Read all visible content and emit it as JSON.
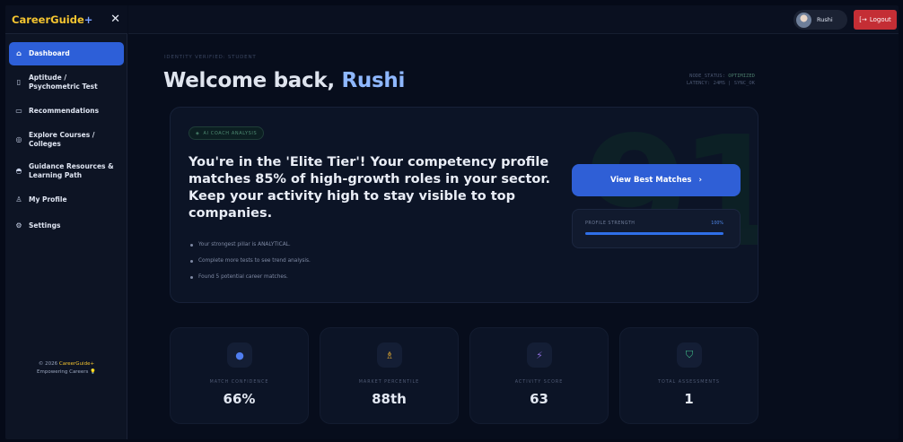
{
  "sidebar": {
    "brand": "CareerGuide",
    "brand_suffix": "+",
    "close": "✕",
    "items": [
      {
        "label": "Dashboard",
        "icon": "⌂"
      },
      {
        "label": "Aptitude / Psychometric Test",
        "icon": "▯"
      },
      {
        "label": "Recommendations",
        "icon": "▭"
      },
      {
        "label": "Explore Courses / Colleges",
        "icon": "◎"
      },
      {
        "label": "Guidance Resources & Learning Path",
        "icon": "◓"
      },
      {
        "label": "My Profile",
        "icon": "♙"
      },
      {
        "label": "Settings",
        "icon": "⚙"
      }
    ],
    "footer_prefix": "© 2026 ",
    "footer_brand": "CareerGuide+",
    "footer_tagline": "Empowering Careers",
    "footer_emoji": "💡"
  },
  "header": {
    "user_name": "Rushi",
    "logout_label": "Logout",
    "logout_icon": "[→"
  },
  "main": {
    "identity": "IDENTITY VERIFIED: STUDENT",
    "welcome_prefix": "Welcome back, ",
    "welcome_name": "Rushi",
    "node_status_label": "NODE_STATUS: ",
    "node_status_value": "OPTIMIZED",
    "latency": "LATENCY: 24MS | SYNC_OK"
  },
  "hero": {
    "badge": "AI COACH ANALYSIS",
    "badge_icon": "◈",
    "message": "You're in the 'Elite Tier'! Your competency profile matches 85% of high-growth roles in your sector. Keep your activity high to stay visible to top companies.",
    "bullets": [
      "Your strongest pillar is ANALYTICAL.",
      "Complete more tests to see trend analysis.",
      "Found 5 potential career matches."
    ],
    "cta_label": "View Best Matches",
    "cta_icon": "›",
    "strength_label": "PROFILE STRENGTH",
    "strength_value": "100%",
    "strength_fraction": 1.0,
    "bg_watermark": "91"
  },
  "stats": [
    {
      "label": "MATCH CONFIDENCE",
      "value": "66%",
      "icon": "●",
      "color": "#4f7df0"
    },
    {
      "label": "MARKET PERCENTILE",
      "value": "88th",
      "icon": "♗",
      "color": "#e0a830"
    },
    {
      "label": "ACTIVITY SCORE",
      "value": "63",
      "icon": "⚡",
      "color": "#8a6ad8"
    },
    {
      "label": "TOTAL ASSESSMENTS",
      "value": "1",
      "icon": "⛉",
      "color": "#3fbf8a"
    }
  ]
}
